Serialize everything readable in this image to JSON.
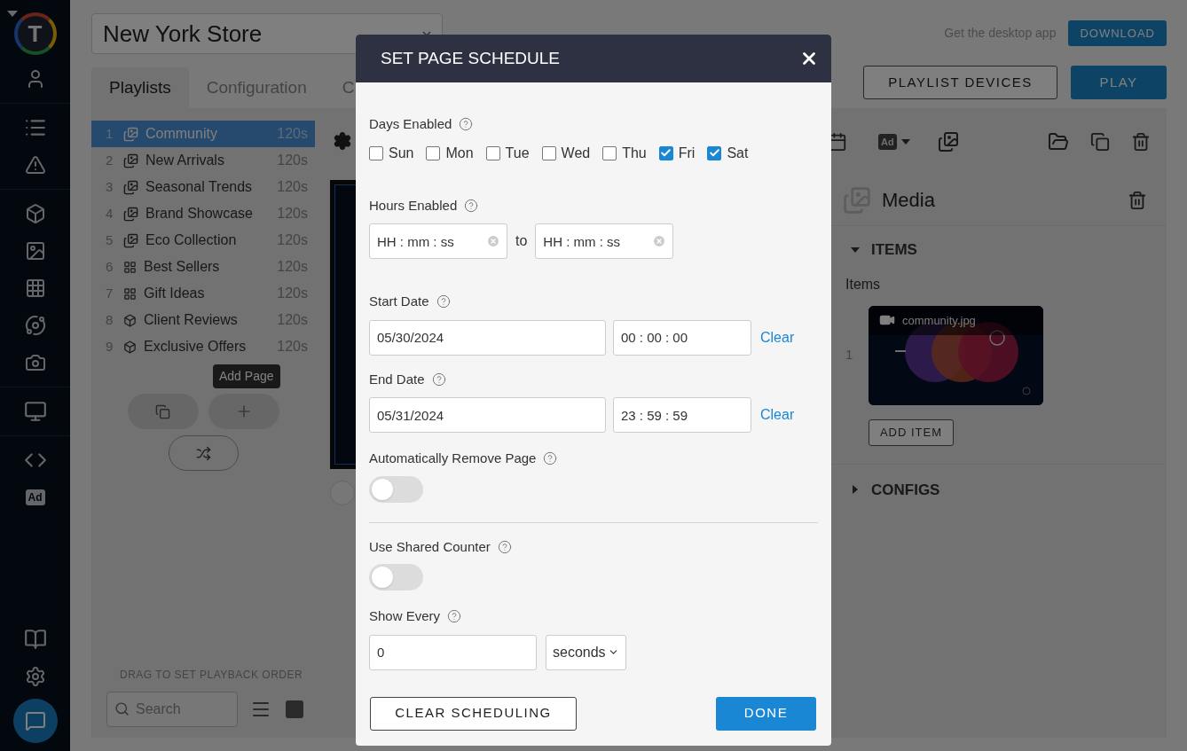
{
  "sidebar": {
    "logo_letter": "T",
    "ad_label": "Ad"
  },
  "store_select": {
    "value": "New York Store"
  },
  "tabs": [
    {
      "label": "Playlists",
      "selected": true
    },
    {
      "label": "Configuration",
      "selected": false
    },
    {
      "label": "C",
      "selected": false
    }
  ],
  "desktop_app": {
    "text": "Get the desktop app",
    "button": "DOWNLOAD"
  },
  "actions": [
    "PLAYLIST DEVICES",
    "PLAY"
  ],
  "pages": [
    {
      "number": "1",
      "name": "Community",
      "duration": "120s",
      "kind": "media",
      "selected": true
    },
    {
      "number": "2",
      "name": "New Arrivals",
      "duration": "120s",
      "kind": "media",
      "selected": false
    },
    {
      "number": "3",
      "name": "Seasonal Trends",
      "duration": "120s",
      "kind": "media",
      "selected": false
    },
    {
      "number": "4",
      "name": "Brand Showcase",
      "duration": "120s",
      "kind": "media",
      "selected": false
    },
    {
      "number": "5",
      "name": "Eco Collection",
      "duration": "120s",
      "kind": "media",
      "selected": false
    },
    {
      "number": "6",
      "name": "Best Sellers",
      "duration": "120s",
      "kind": "grid",
      "selected": false
    },
    {
      "number": "7",
      "name": "Gift Ideas",
      "duration": "120s",
      "kind": "grid",
      "selected": false
    },
    {
      "number": "8",
      "name": "Client Reviews",
      "duration": "120s",
      "kind": "cube",
      "selected": false
    },
    {
      "number": "9",
      "name": "Exclusive Offers",
      "duration": "120s",
      "kind": "cube",
      "selected": false
    }
  ],
  "tooltip": "Add Page",
  "drag_hint": "DRAG TO SET PLAYBACK ORDER",
  "search": {
    "placeholder": "Search"
  },
  "toolbar": {
    "ad_label": "Ad"
  },
  "media_panel": {
    "title": "Media",
    "items_section": {
      "title": "ITEMS",
      "expanded": true,
      "label": "Items",
      "items": [
        {
          "number": "1",
          "file": "community.jpg"
        }
      ],
      "add_button": "ADD ITEM"
    },
    "configs_section": {
      "title": "CONFIGS",
      "expanded": false
    }
  },
  "dialog": {
    "title": "SET PAGE SCHEDULE",
    "days": {
      "label": "Days Enabled",
      "options": [
        {
          "label": "Sun",
          "checked": false
        },
        {
          "label": "Mon",
          "checked": false
        },
        {
          "label": "Tue",
          "checked": false
        },
        {
          "label": "Wed",
          "checked": false
        },
        {
          "label": "Thu",
          "checked": false
        },
        {
          "label": "Fri",
          "checked": true
        },
        {
          "label": "Sat",
          "checked": true
        }
      ]
    },
    "hours": {
      "label": "Hours Enabled",
      "from": {
        "placeholder": "HH : mm : ss"
      },
      "separator": "to",
      "to": {
        "placeholder": "HH : mm : ss"
      }
    },
    "start": {
      "label": "Start Date",
      "date": "05/30/2024",
      "time": "00 : 00 : 00",
      "clear": "Clear"
    },
    "end": {
      "label": "End Date",
      "date": "05/31/2024",
      "time": "23 : 59 : 59",
      "clear": "Clear"
    },
    "auto_remove": {
      "label": "Automatically Remove Page",
      "on": false
    },
    "shared_counter": {
      "label": "Use Shared Counter",
      "on": false
    },
    "show_every": {
      "label": "Show Every",
      "value": "0",
      "unit": "seconds"
    },
    "buttons": {
      "clear": "CLEAR SCHEDULING",
      "done": "DONE"
    }
  }
}
